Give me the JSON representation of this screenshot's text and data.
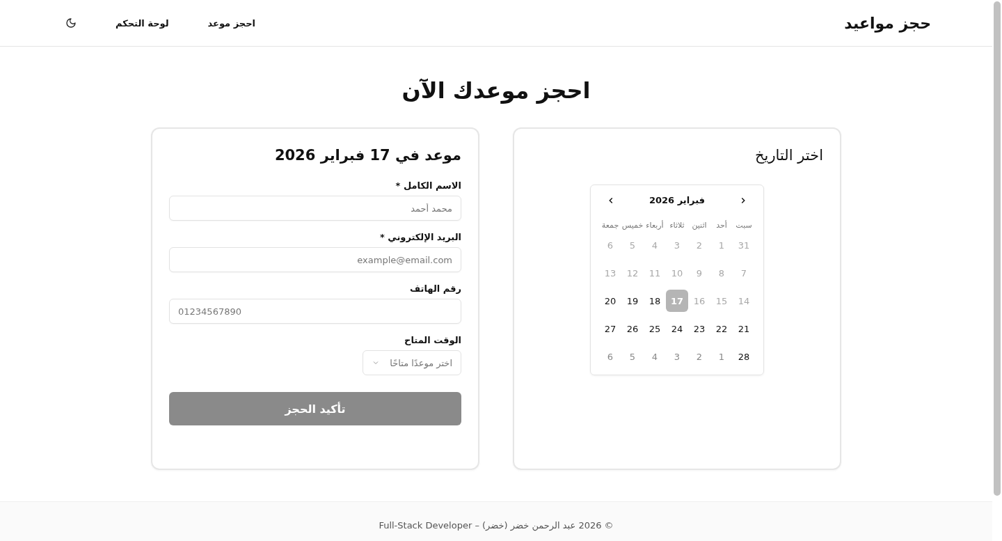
{
  "header": {
    "brand": "حجز مواعيد",
    "nav": [
      {
        "label": "احجز موعد"
      },
      {
        "label": "لوحة التحكم"
      }
    ]
  },
  "page_title": "احجز موعدك الآن",
  "date_card": {
    "title": "اختر التاريخ",
    "calendar": {
      "month": "فبراير 2026",
      "weekdays": [
        "سبت",
        "أحد",
        "اثنين",
        "ثلاثاء",
        "أربعاء",
        "خميس",
        "جمعة"
      ],
      "days": [
        {
          "label": "31",
          "kind": "past",
          "selected": false
        },
        {
          "label": "1",
          "kind": "past",
          "selected": false
        },
        {
          "label": "2",
          "kind": "past",
          "selected": false
        },
        {
          "label": "3",
          "kind": "past",
          "selected": false
        },
        {
          "label": "4",
          "kind": "past",
          "selected": false
        },
        {
          "label": "5",
          "kind": "past",
          "selected": false
        },
        {
          "label": "6",
          "kind": "past",
          "selected": false
        },
        {
          "label": "7",
          "kind": "past",
          "selected": false
        },
        {
          "label": "8",
          "kind": "past",
          "selected": false
        },
        {
          "label": "9",
          "kind": "past",
          "selected": false
        },
        {
          "label": "10",
          "kind": "past",
          "selected": false
        },
        {
          "label": "11",
          "kind": "past",
          "selected": false
        },
        {
          "label": "12",
          "kind": "past",
          "selected": false
        },
        {
          "label": "13",
          "kind": "past",
          "selected": false
        },
        {
          "label": "14",
          "kind": "past",
          "selected": false
        },
        {
          "label": "15",
          "kind": "past",
          "selected": false
        },
        {
          "label": "16",
          "kind": "past",
          "selected": false
        },
        {
          "label": "17",
          "kind": "available",
          "selected": true
        },
        {
          "label": "18",
          "kind": "available",
          "selected": false
        },
        {
          "label": "19",
          "kind": "available",
          "selected": false
        },
        {
          "label": "20",
          "kind": "available",
          "selected": false
        },
        {
          "label": "21",
          "kind": "available",
          "selected": false
        },
        {
          "label": "22",
          "kind": "available",
          "selected": false
        },
        {
          "label": "23",
          "kind": "available",
          "selected": false
        },
        {
          "label": "24",
          "kind": "available",
          "selected": false
        },
        {
          "label": "25",
          "kind": "available",
          "selected": false
        },
        {
          "label": "26",
          "kind": "available",
          "selected": false
        },
        {
          "label": "27",
          "kind": "available",
          "selected": false
        },
        {
          "label": "28",
          "kind": "available",
          "selected": false
        },
        {
          "label": "1",
          "kind": "next_month",
          "selected": false
        },
        {
          "label": "2",
          "kind": "next_month",
          "selected": false
        },
        {
          "label": "3",
          "kind": "next_month",
          "selected": false
        },
        {
          "label": "4",
          "kind": "next_month",
          "selected": false
        },
        {
          "label": "5",
          "kind": "next_month",
          "selected": false
        },
        {
          "label": "6",
          "kind": "next_month",
          "selected": false
        }
      ]
    }
  },
  "form_card": {
    "title": "موعد في 17 فبراير 2026",
    "fields": [
      {
        "label": "الاسم الكامل *",
        "kind": "text",
        "placeholder": "محمد أحمد"
      },
      {
        "label": "البريد الإلكتروني *",
        "kind": "email",
        "placeholder": "example@email.com"
      },
      {
        "label": "رقم الهاتف",
        "kind": "phone",
        "placeholder": "01234567890"
      },
      {
        "label": "الوقت المتاح",
        "kind": "select",
        "placeholder": "اختر موعدًا متاحًا"
      }
    ],
    "submit": {
      "label": "تأكيد الحجز",
      "disabled": true
    }
  },
  "footer": {
    "copyright": "© 2026 عبد الرحمن خضر (خضر) – Full-Stack Developer"
  }
}
